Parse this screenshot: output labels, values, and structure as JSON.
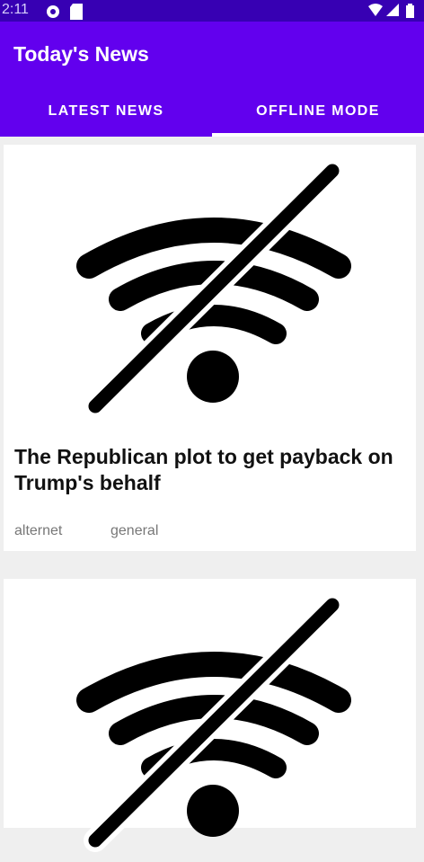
{
  "status_bar": {
    "time": "2:11",
    "icons": [
      "sync-icon",
      "sd-card-icon",
      "wifi-icon",
      "signal-icon",
      "battery-icon"
    ]
  },
  "app_bar": {
    "title": "Today's News",
    "color": "#6200ee",
    "status_color": "#3700b3"
  },
  "tabs": [
    {
      "label": "LATEST NEWS",
      "selected": false
    },
    {
      "label": "OFFLINE MODE",
      "selected": true
    }
  ],
  "articles": [
    {
      "title": "The Republican plot to get payback on Trump's behalf",
      "source": "alternet",
      "category": "general",
      "image_icon": "wifi-off-icon"
    },
    {
      "title": "",
      "source": "",
      "category": "",
      "image_icon": "wifi-off-icon"
    }
  ]
}
